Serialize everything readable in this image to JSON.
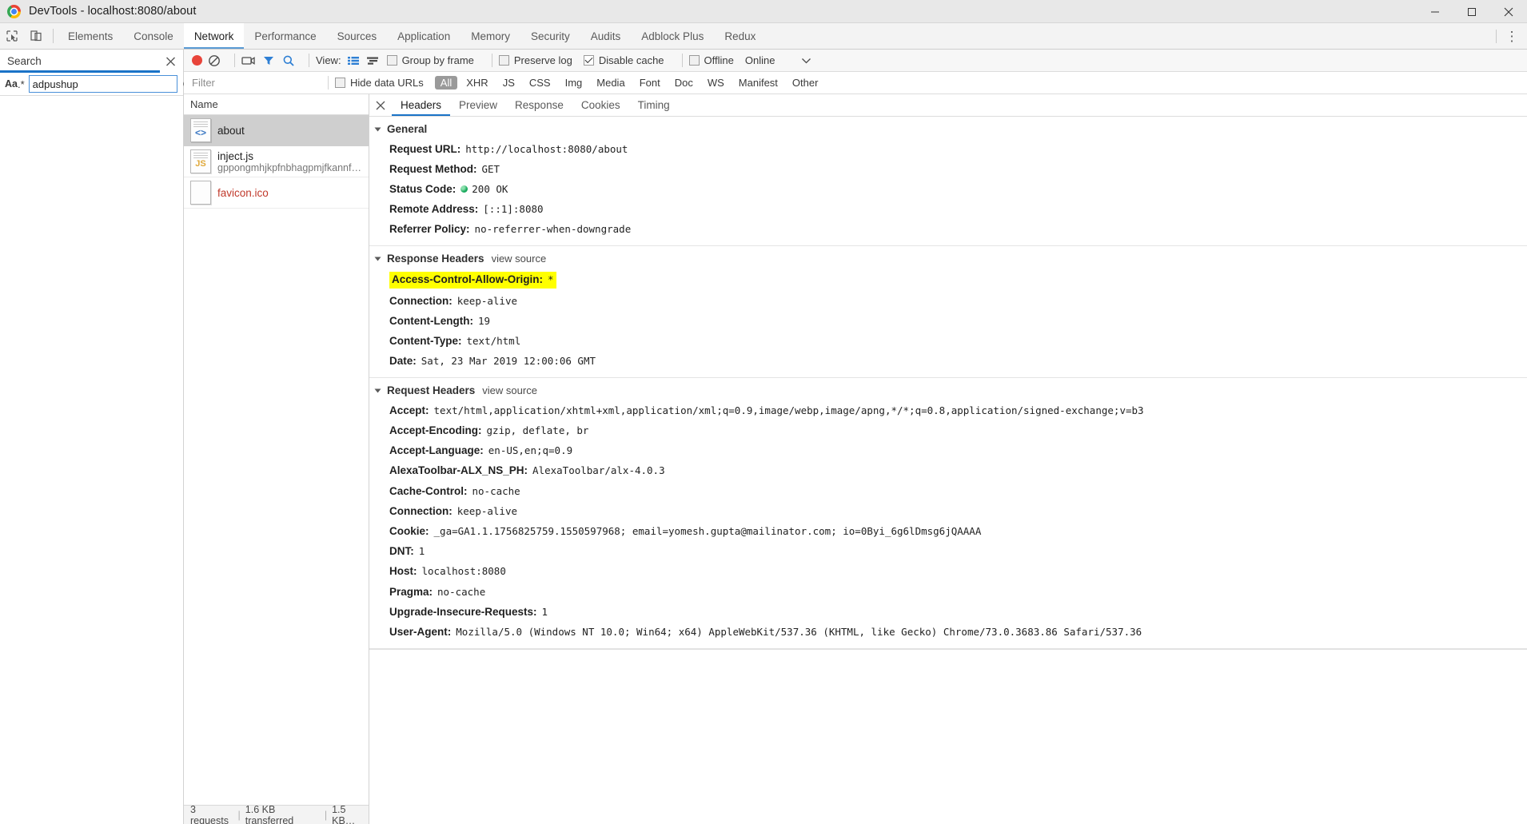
{
  "window": {
    "title": "DevTools - localhost:8080/about",
    "icon": "chrome-logo",
    "controls": {
      "minimize": "–",
      "maximize": "□",
      "close": "✕"
    }
  },
  "devtools_tabs": {
    "items": [
      {
        "label": "Elements",
        "active": false
      },
      {
        "label": "Console",
        "active": false
      },
      {
        "label": "Network",
        "active": true
      },
      {
        "label": "Performance",
        "active": false
      },
      {
        "label": "Sources",
        "active": false
      },
      {
        "label": "Application",
        "active": false
      },
      {
        "label": "Memory",
        "active": false
      },
      {
        "label": "Security",
        "active": false
      },
      {
        "label": "Audits",
        "active": false
      },
      {
        "label": "Adblock Plus",
        "active": false
      },
      {
        "label": "Redux",
        "active": false
      }
    ],
    "menu_glyph": "⋮"
  },
  "search_panel": {
    "title": "Search",
    "close_glyph": "✕",
    "match_case_label": "Aa",
    "regex_label": ".*",
    "query": "adpushup",
    "placeholder": "",
    "refresh_glyph": "⟳",
    "clear_glyph": "⊘"
  },
  "network_toolbar": {
    "record_title": "Record",
    "clear_title": "Clear",
    "view_label": "View:",
    "group_by_frame": {
      "label": "Group by frame",
      "checked": false
    },
    "preserve_log": {
      "label": "Preserve log",
      "checked": false
    },
    "disable_cache": {
      "label": "Disable cache",
      "checked": true
    },
    "offline": {
      "label": "Offline",
      "checked": false
    },
    "throttling": "Online",
    "caret_glyph": "▼"
  },
  "filter_bar": {
    "placeholder": "Filter",
    "value": "",
    "hide_data_urls": {
      "label": "Hide data URLs",
      "checked": false
    },
    "types": [
      {
        "label": "All",
        "active": true
      },
      {
        "label": "XHR",
        "active": false
      },
      {
        "label": "JS",
        "active": false
      },
      {
        "label": "CSS",
        "active": false
      },
      {
        "label": "Img",
        "active": false
      },
      {
        "label": "Media",
        "active": false
      },
      {
        "label": "Font",
        "active": false
      },
      {
        "label": "Doc",
        "active": false
      },
      {
        "label": "WS",
        "active": false
      },
      {
        "label": "Manifest",
        "active": false
      },
      {
        "label": "Other",
        "active": false
      }
    ]
  },
  "requests": {
    "column_header": "Name",
    "rows": [
      {
        "name": "about",
        "sub": "",
        "icon": "document-code-icon",
        "selected": true,
        "error": false
      },
      {
        "name": "inject.js",
        "sub": "gppongmhjkpfnbhagpmjfkannfb…",
        "icon": "document-js-icon",
        "selected": false,
        "error": false
      },
      {
        "name": "favicon.ico",
        "sub": "",
        "icon": "document-blank-icon",
        "selected": false,
        "error": true
      }
    ],
    "status": {
      "requests": "3 requests",
      "transferred": "1.6 KB transferred",
      "resources": "1.5 KB…",
      "sep": "|"
    }
  },
  "detail": {
    "close_glyph": "✕",
    "tabs": [
      {
        "label": "Headers",
        "active": true
      },
      {
        "label": "Preview",
        "active": false
      },
      {
        "label": "Response",
        "active": false
      },
      {
        "label": "Cookies",
        "active": false
      },
      {
        "label": "Timing",
        "active": false
      }
    ],
    "sections": [
      {
        "title": "General",
        "view_source": "",
        "rows": [
          {
            "key": "Request URL:",
            "value": "http://localhost:8080/about"
          },
          {
            "key": "Request Method:",
            "value": "GET"
          },
          {
            "key": "Status Code:",
            "value": "200 OK",
            "status_dot": true
          },
          {
            "key": "Remote Address:",
            "value": "[::1]:8080"
          },
          {
            "key": "Referrer Policy:",
            "value": "no-referrer-when-downgrade"
          }
        ]
      },
      {
        "title": "Response Headers",
        "view_source": "view source",
        "rows": [
          {
            "key": "Access-Control-Allow-Origin:",
            "value": "*",
            "highlight": true
          },
          {
            "key": "Connection:",
            "value": "keep-alive"
          },
          {
            "key": "Content-Length:",
            "value": "19"
          },
          {
            "key": "Content-Type:",
            "value": "text/html"
          },
          {
            "key": "Date:",
            "value": "Sat, 23 Mar 2019 12:00:06 GMT"
          }
        ]
      },
      {
        "title": "Request Headers",
        "view_source": "view source",
        "rows": [
          {
            "key": "Accept:",
            "value": "text/html,application/xhtml+xml,application/xml;q=0.9,image/webp,image/apng,*/*;q=0.8,application/signed-exchange;v=b3"
          },
          {
            "key": "Accept-Encoding:",
            "value": "gzip, deflate, br"
          },
          {
            "key": "Accept-Language:",
            "value": "en-US,en;q=0.9"
          },
          {
            "key": "AlexaToolbar-ALX_NS_PH:",
            "value": "AlexaToolbar/alx-4.0.3"
          },
          {
            "key": "Cache-Control:",
            "value": "no-cache"
          },
          {
            "key": "Connection:",
            "value": "keep-alive"
          },
          {
            "key": "Cookie:",
            "value": "_ga=GA1.1.1756825759.1550597968; email=yomesh.gupta@mailinator.com; io=0Byi_6g6lDmsg6jQAAAA"
          },
          {
            "key": "DNT:",
            "value": "1"
          },
          {
            "key": "Host:",
            "value": "localhost:8080"
          },
          {
            "key": "Pragma:",
            "value": "no-cache"
          },
          {
            "key": "Upgrade-Insecure-Requests:",
            "value": "1"
          },
          {
            "key": "User-Agent:",
            "value": "Mozilla/5.0 (Windows NT 10.0; Win64; x64) AppleWebKit/537.36 (KHTML, like Gecko) Chrome/73.0.3683.86 Safari/537.36"
          }
        ]
      }
    ]
  },
  "colors": {
    "accent": "#1a73c7",
    "highlight": "#ffff00",
    "record": "#e8443a",
    "status_ok": "#18a95c",
    "error_text": "#c0392b"
  }
}
